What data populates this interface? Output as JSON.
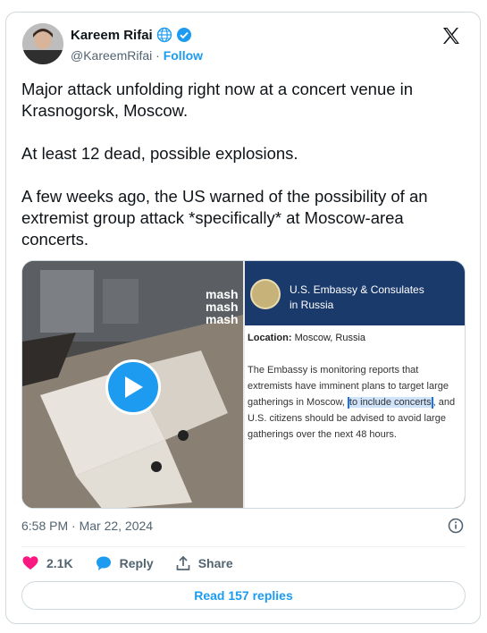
{
  "author": {
    "name": "Kareem Rifai",
    "handle": "@KareemRifai",
    "separator": "·",
    "follow_label": "Follow"
  },
  "tweet": {
    "paragraphs": [
      "Major attack unfolding right now at a concert venue in Krasnogorsk, Moscow.",
      "At least 12 dead, possible explosions.",
      "A few weeks ago, the US warned of the possibility of an extremist group attack *specifically* at Moscow-area concerts."
    ]
  },
  "media": {
    "video_watermark": [
      "mash",
      "mash",
      "mash"
    ],
    "embassy": {
      "title_line1": "U.S. Embassy & Consulates",
      "title_line2": "in Russia",
      "location_label": "Location:",
      "location_value": "Moscow, Russia",
      "body_part1": "The Embassy is monitoring reports that extremists have imminent plans to target large gatherings in Moscow, ",
      "body_highlight": "to include concerts",
      "body_part2": ", and U.S. citizens should be advised to avoid large gatherings over the next 48 hours."
    }
  },
  "timestamp": "6:58 PM · Mar 22, 2024",
  "actions": {
    "like_count": "2.1K",
    "reply_label": "Reply",
    "share_label": "Share"
  },
  "read_replies_label": "Read 157 replies",
  "colors": {
    "accent": "#1d9bf0",
    "like": "#f91880",
    "embassy_blue": "#1a3a6b"
  }
}
